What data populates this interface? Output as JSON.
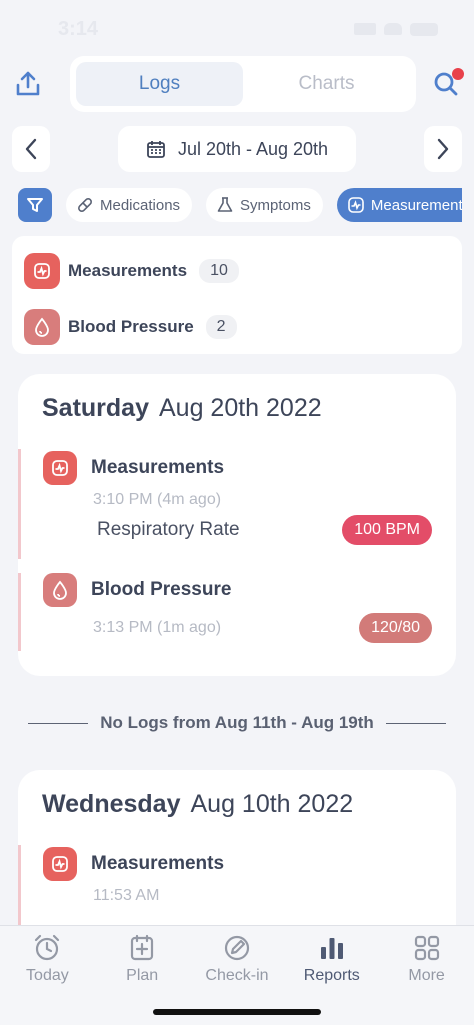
{
  "status": {
    "time": "3:14"
  },
  "header": {
    "tabs": [
      {
        "label": "Logs",
        "active": true
      },
      {
        "label": "Charts",
        "active": false
      }
    ]
  },
  "date_range": {
    "label": "Jul 20th - Aug 20th"
  },
  "filters": {
    "chips": [
      {
        "label": "Medications",
        "icon": "pill-icon"
      },
      {
        "label": "Symptoms",
        "icon": "flask-icon"
      },
      {
        "label": "Measurements",
        "icon": "pulse-icon",
        "active": true
      }
    ]
  },
  "summary": {
    "rows": [
      {
        "label": "Measurements",
        "count": "10",
        "color": "#e6625e"
      },
      {
        "label": "Blood Pressure",
        "count": "2",
        "color": "#d87d7c"
      }
    ]
  },
  "days": [
    {
      "weekday": "Saturday",
      "date": "Aug 20th 2022",
      "entries": [
        {
          "name": "Measurements",
          "time": "3:10 PM (4m ago)",
          "metric": "Respiratory Rate",
          "value": "100 BPM",
          "value_color": "#e34d68",
          "icon_color": "#e6625e"
        },
        {
          "name": "Blood Pressure",
          "time": "3:13 PM (1m ago)",
          "metric": "",
          "value": "120/80",
          "value_color": "#d27b79",
          "icon_color": "#d87d7c"
        }
      ]
    },
    {
      "weekday": "Wednesday",
      "date": "Aug 10th 2022",
      "entries": [
        {
          "name": "Measurements",
          "time": "11:53 AM",
          "metric": "",
          "value": "",
          "icon_color": "#e6625e"
        }
      ]
    }
  ],
  "gap": {
    "label": "No Logs from Aug 11th  -  Aug 19th"
  },
  "tabbar": {
    "items": [
      {
        "label": "Today",
        "icon": "alarm-clock-icon"
      },
      {
        "label": "Plan",
        "icon": "plan-add-icon"
      },
      {
        "label": "Check-in",
        "icon": "pencil-square-icon"
      },
      {
        "label": "Reports",
        "icon": "bar-chart-icon",
        "active": true
      },
      {
        "label": "More",
        "icon": "grid-icon"
      }
    ]
  }
}
